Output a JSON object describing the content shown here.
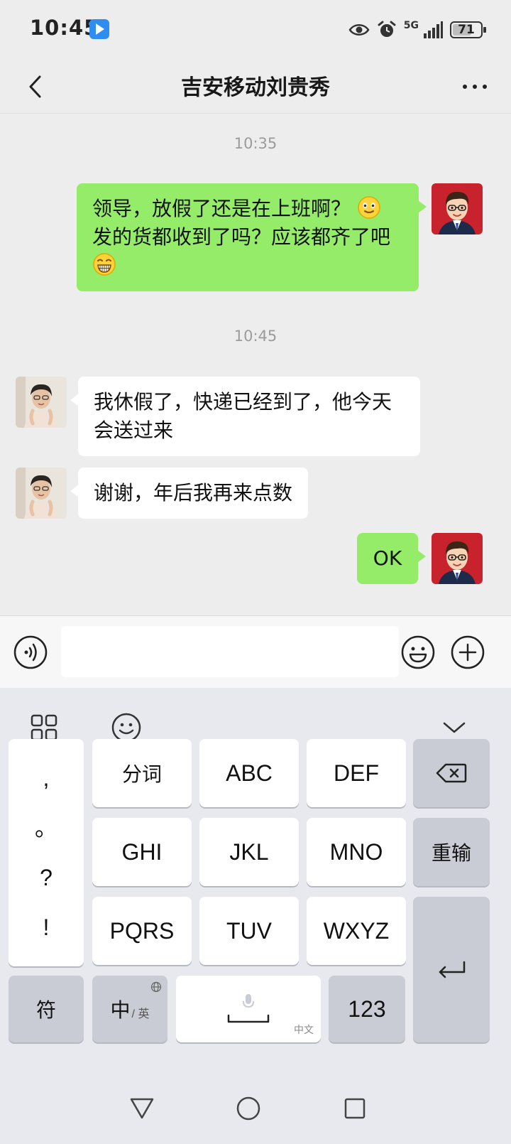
{
  "status_bar": {
    "time": "10:45",
    "network": "5G",
    "battery": "71",
    "battery_level": 0.71
  },
  "header": {
    "title": "吉安移动刘贵秀"
  },
  "messages": [
    {
      "type": "timestamp",
      "text": "10:35"
    },
    {
      "type": "bubble",
      "sender": "me",
      "line1": "领导，放假了还是在上班啊？",
      "line2": "发的货都收到了吗？应该都齐了吧",
      "emojis": [
        "smile-emoji",
        "grin-emoji"
      ]
    },
    {
      "type": "timestamp",
      "text": "10:45"
    },
    {
      "type": "bubble",
      "sender": "other",
      "text": "我休假了，快递已经到了，他今天会送过来"
    },
    {
      "type": "bubble",
      "sender": "other",
      "text": "谢谢，年后我再来点数"
    },
    {
      "type": "bubble",
      "sender": "me",
      "text": "OK"
    }
  ],
  "input": {
    "value": ""
  },
  "keyboard": {
    "punctuation": [
      ",",
      "。",
      "?",
      "!"
    ],
    "row1": [
      "分词",
      "ABC",
      "DEF"
    ],
    "row2": [
      "GHI",
      "JKL",
      "MNO"
    ],
    "row2_right": "重输",
    "row3": [
      "PQRS",
      "TUV",
      "WXYZ"
    ],
    "symbols": "符",
    "lang_main": "中",
    "lang_sub": "/ 英",
    "space_sub": "中文",
    "numbers": "123"
  },
  "colors": {
    "my_bubble": "#95ec69",
    "their_bubble": "#ffffff",
    "background": "#ededed"
  }
}
